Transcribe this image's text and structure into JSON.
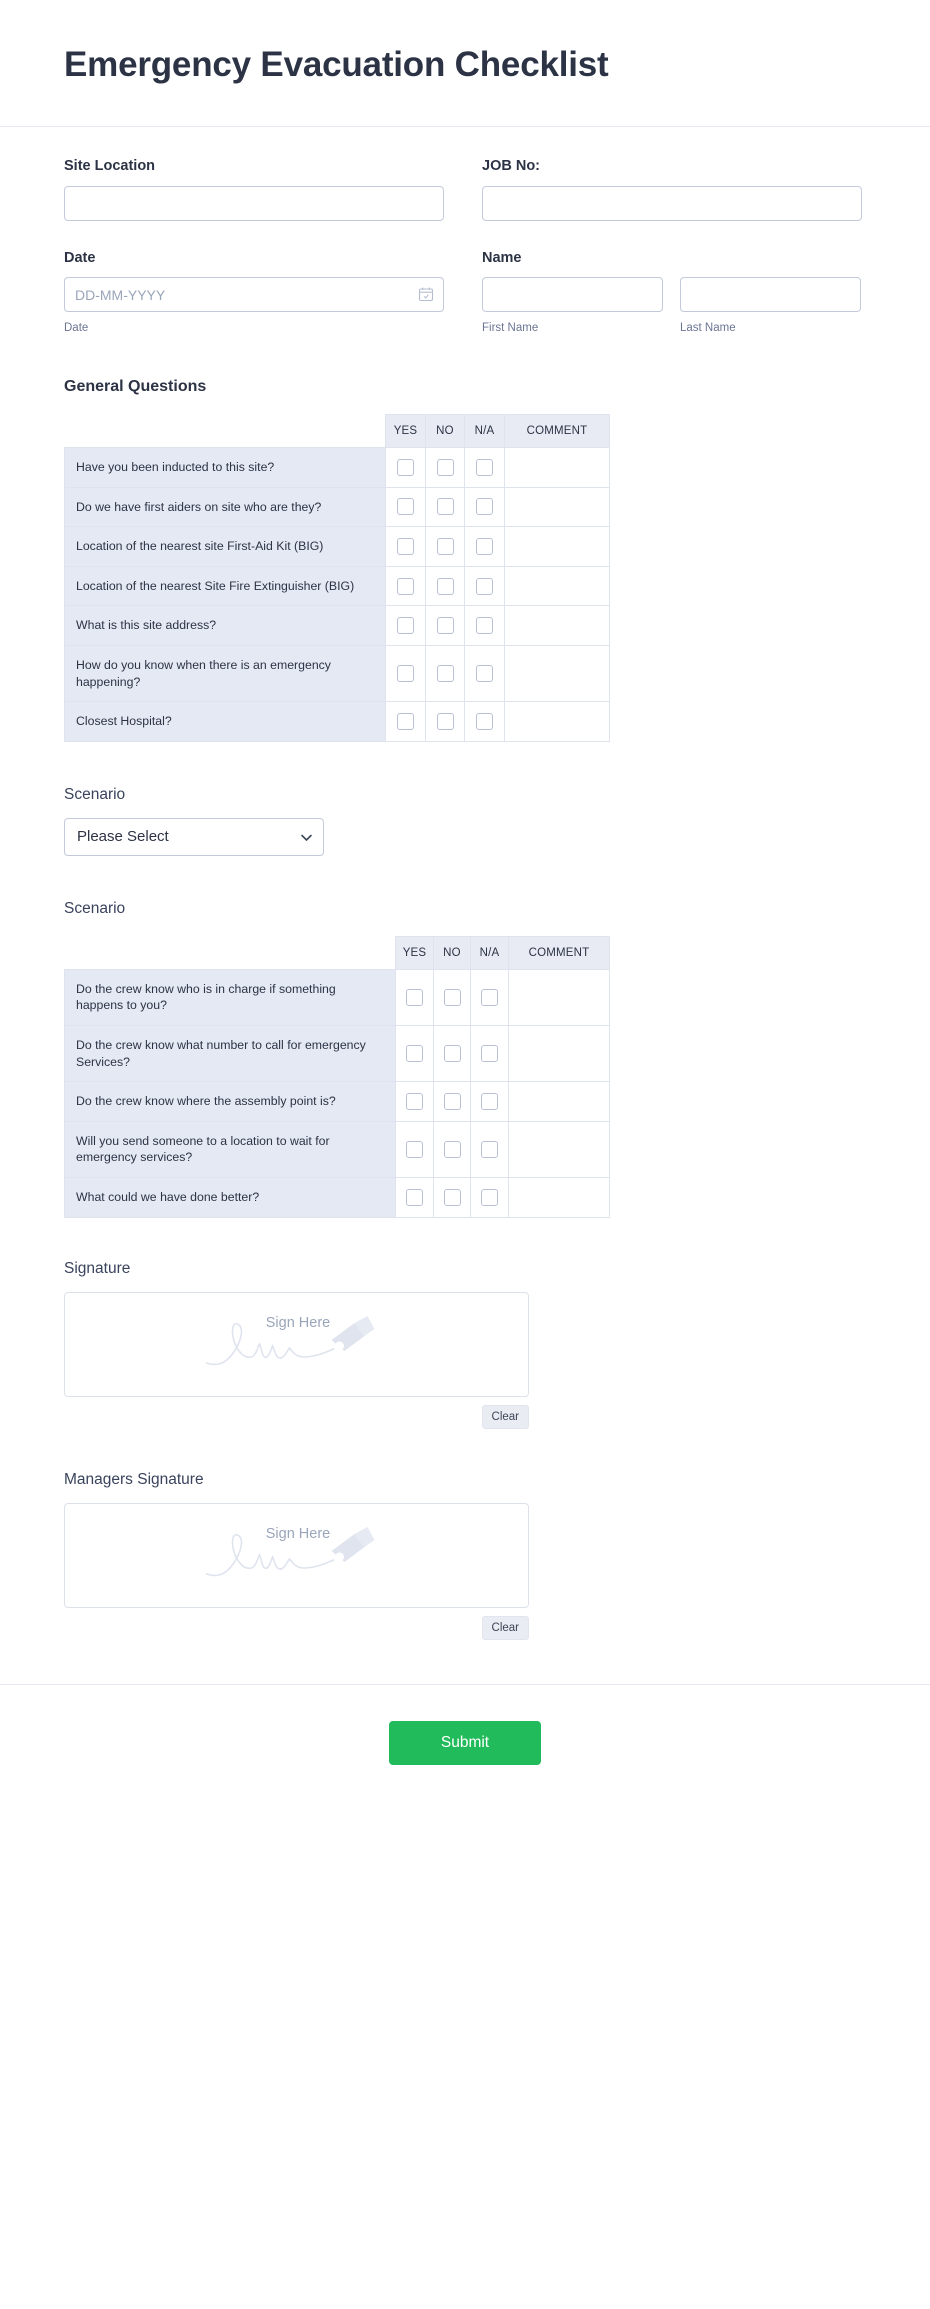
{
  "form": {
    "title": "Emergency Evacuation Checklist",
    "submit_label": "Submit"
  },
  "fields": {
    "site_location": {
      "label": "Site Location",
      "value": "",
      "placeholder": ""
    },
    "job_no": {
      "label": "JOB No:",
      "value": "",
      "placeholder": ""
    },
    "date": {
      "label": "Date",
      "placeholder": "DD-MM-YYYY",
      "value": "",
      "sublabel": "Date",
      "icon": "calendar-icon"
    },
    "name": {
      "label": "Name",
      "first": {
        "value": "",
        "placeholder": "",
        "sublabel": "First Name"
      },
      "last": {
        "value": "",
        "placeholder": "",
        "sublabel": "Last Name"
      }
    },
    "scenario_select": {
      "label": "Scenario",
      "selected": "Please Select",
      "options": [
        "Please Select"
      ],
      "icon": "chevron-down-icon"
    }
  },
  "general_questions": {
    "title": "General Questions",
    "columns": [
      "YES",
      "NO",
      "N/A",
      "COMMENT"
    ],
    "rows": [
      "Have you been inducted to this site?",
      "Do we have first aiders on site who are they?",
      "Location of the nearest site First-Aid Kit (BIG)",
      "Location of the nearest Site Fire Extinguisher (BIG)",
      "What is this site address?",
      "How do you know when there is an emergency happening?",
      "Closest Hospital?"
    ]
  },
  "scenario_table": {
    "title": "Scenario",
    "columns": [
      "YES",
      "NO",
      "N/A",
      "COMMENT"
    ],
    "rows": [
      "Do the crew know who is in charge if something happens to you?",
      "Do the crew know what number to call for emergency Services?",
      "Do the crew know where the assembly point is?",
      "Will you send someone to a location to wait for emergency services?",
      "What could we have done better?"
    ]
  },
  "signature": {
    "label": "Signature",
    "placeholder_text": "Sign Here",
    "clear_label": "Clear"
  },
  "managers_signature": {
    "label": "Managers Signature",
    "placeholder_text": "Sign Here",
    "clear_label": "Clear"
  },
  "colors": {
    "accent": "#22bb5b",
    "text": "#2c3345",
    "row_bg": "#e5e9f3",
    "header_bg": "#e8ebf4",
    "border": "#dfe3ed",
    "placeholder": "#9aa5ba"
  }
}
